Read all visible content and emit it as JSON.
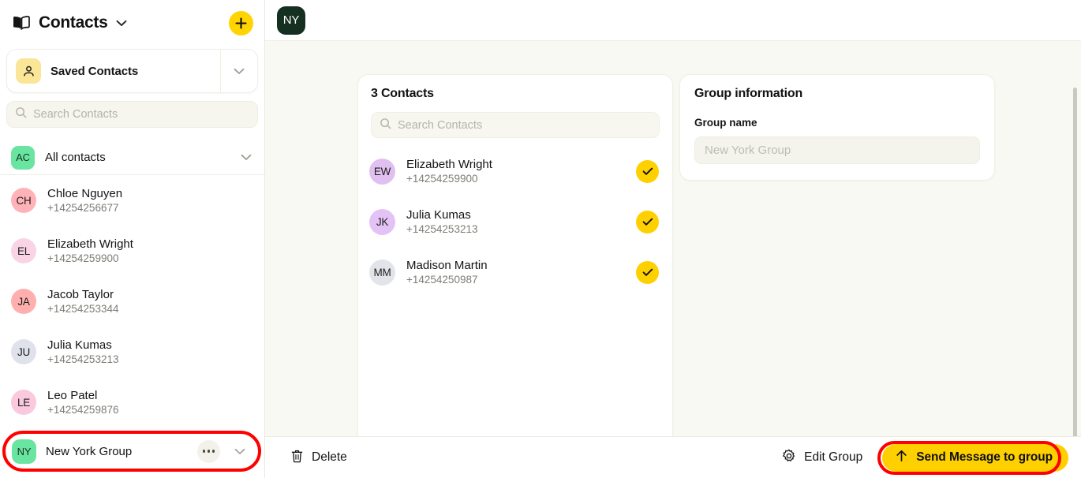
{
  "sidebar": {
    "header": {
      "title": "Contacts",
      "book_icon": "book-icon",
      "chevron_icon": "chevron-down-icon",
      "add_label": "+"
    },
    "saved_card": {
      "label": "Saved Contacts",
      "avatar_icon": "person-icon"
    },
    "search": {
      "placeholder": "Search Contacts",
      "value": "",
      "icon": "search-icon"
    },
    "all_contacts": {
      "initials": "AC",
      "label": "All contacts"
    },
    "contacts": [
      {
        "initials": "CH",
        "name": "Chloe Nguyen",
        "phone": "+14254256677",
        "color": "#ffb3b8"
      },
      {
        "initials": "EL",
        "name": "Elizabeth Wright",
        "phone": "+14254259900",
        "color": "#f8d4e4"
      },
      {
        "initials": "JA",
        "name": "Jacob Taylor",
        "phone": "+14254253344",
        "color": "#ffb0ae"
      },
      {
        "initials": "JU",
        "name": "Julia Kumas",
        "phone": "+14254253213",
        "color": "#dfe2ea"
      },
      {
        "initials": "LE",
        "name": "Leo Patel",
        "phone": "+14254259876",
        "color": "#fbc9dd"
      }
    ],
    "group_row": {
      "initials": "NY",
      "name": "New York Group",
      "menu_icon": "more-dots-icon",
      "chevron_icon": "chevron-down-icon"
    }
  },
  "topbar": {
    "badge_initials": "NY"
  },
  "contacts_panel": {
    "title": "3 Contacts",
    "search": {
      "placeholder": "Search Contacts",
      "value": "",
      "icon": "search-icon"
    },
    "members": [
      {
        "initials": "EW",
        "name": "Elizabeth Wright",
        "phone": "+14254259900",
        "color": "#e0c0f0",
        "selected": true
      },
      {
        "initials": "JK",
        "name": "Julia Kumas",
        "phone": "+14254253213",
        "color": "#e3c3f5",
        "selected": true
      },
      {
        "initials": "MM",
        "name": "Madison Martin",
        "phone": "+14254250987",
        "color": "#e2e4ea",
        "selected": true
      }
    ]
  },
  "group_info": {
    "title": "Group information",
    "name_label": "Group name",
    "name_placeholder": "New York Group",
    "name_value": ""
  },
  "bottombar": {
    "delete_label": "Delete",
    "delete_icon": "trash-icon",
    "edit_label": "Edit Group",
    "edit_icon": "gear-icon",
    "send_label": "Send Message to group",
    "send_icon": "arrow-up-icon"
  },
  "colors": {
    "accent_yellow": "#ffd000",
    "highlight_red": "#fe0000",
    "badge_green": "#153020",
    "group_green": "#6ae5a1",
    "main_bg": "#f8f9f3"
  }
}
